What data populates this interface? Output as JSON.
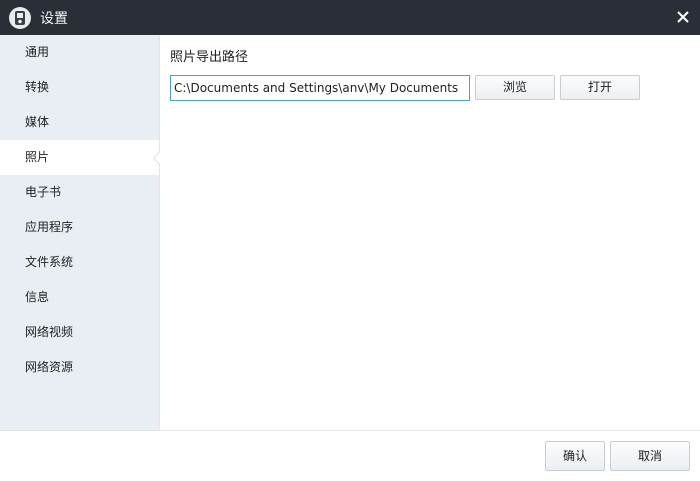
{
  "window": {
    "title": "设置",
    "close_icon": "close-icon",
    "app_icon": "device-icon"
  },
  "sidebar": {
    "items": [
      {
        "label": "通用",
        "active": false
      },
      {
        "label": "转换",
        "active": false
      },
      {
        "label": "媒体",
        "active": false
      },
      {
        "label": "照片",
        "active": true
      },
      {
        "label": "电子书",
        "active": false
      },
      {
        "label": "应用程序",
        "active": false
      },
      {
        "label": "文件系统",
        "active": false
      },
      {
        "label": "信息",
        "active": false
      },
      {
        "label": "网络视频",
        "active": false
      },
      {
        "label": "网络资源",
        "active": false
      }
    ]
  },
  "photo_panel": {
    "section_title": "照片导出路径",
    "path_value": "C:\\Documents and Settings\\anv\\My Documents",
    "browse_label": "浏览",
    "open_label": "打开"
  },
  "footer": {
    "ok_label": "确认",
    "cancel_label": "取消"
  },
  "colors": {
    "titlebar": "#2a2f37",
    "sidebar": "#e9eef5",
    "input_border": "#4a9fd8"
  }
}
